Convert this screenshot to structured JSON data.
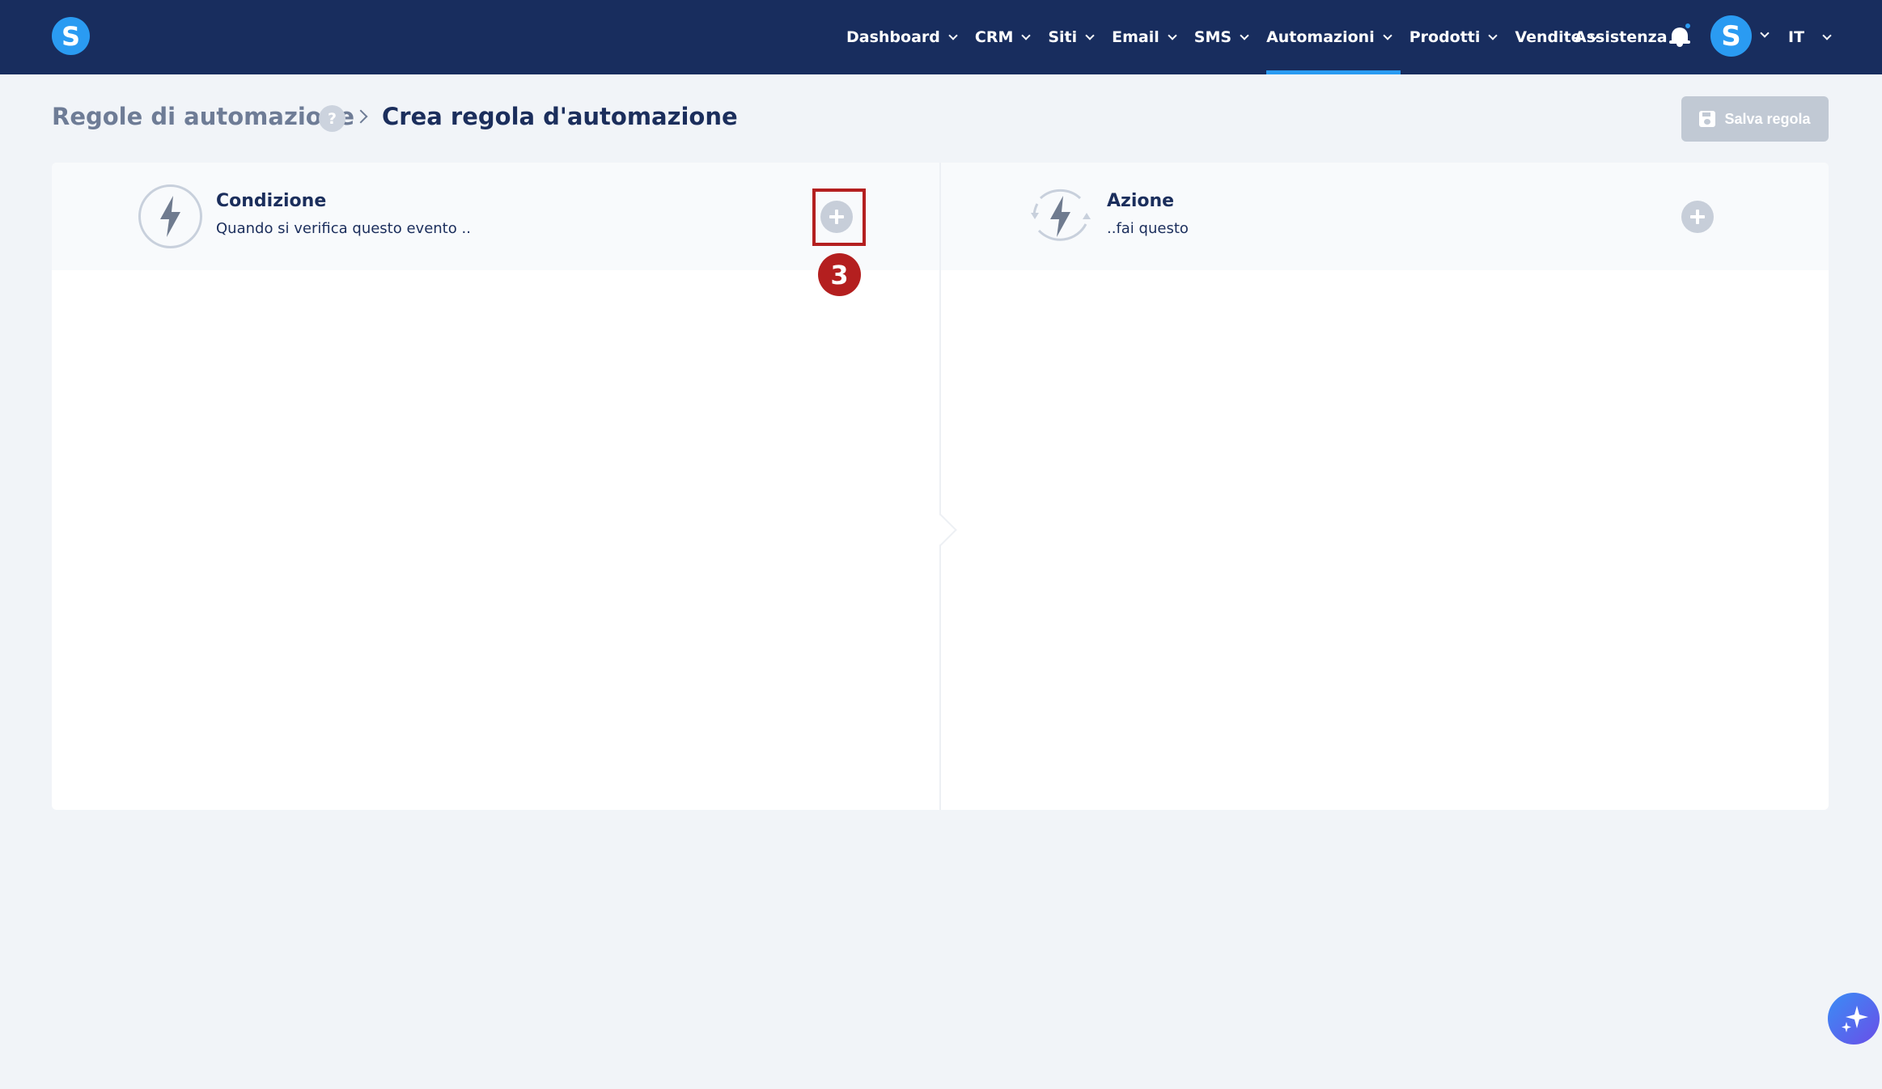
{
  "app": {
    "logo_letter": "S",
    "brand_color": "#182d5e",
    "accent_color": "#2a9bf2"
  },
  "nav": {
    "items": [
      {
        "label": "Dashboard",
        "active": false
      },
      {
        "label": "CRM",
        "active": false
      },
      {
        "label": "Siti",
        "active": false
      },
      {
        "label": "Email",
        "active": false
      },
      {
        "label": "SMS",
        "active": false
      },
      {
        "label": "Automazioni",
        "active": true
      },
      {
        "label": "Prodotti",
        "active": false
      },
      {
        "label": "Vendite",
        "active": false
      }
    ],
    "assistance": "Assistenza",
    "notification_icon": "bell-icon",
    "avatar_letter": "S",
    "language": "IT"
  },
  "breadcrumb": {
    "parent": "Regole di automazione",
    "help": "?",
    "current": "Crea regola d'automazione"
  },
  "toolbar": {
    "save_label": "Salva regola",
    "save_icon": "floppy-disk-icon"
  },
  "editor": {
    "condition": {
      "title": "Condizione",
      "subtitle": "Quando si verifica questo evento ..",
      "icon": "lightning-bolt-icon"
    },
    "action": {
      "title": "Azione",
      "subtitle": "..fai questo",
      "icon": "lightning-bolt-cycle-icon"
    }
  },
  "annotation": {
    "step_number": "3",
    "color": "#b41f1f"
  },
  "assistant_icon": "sparkle-icon"
}
